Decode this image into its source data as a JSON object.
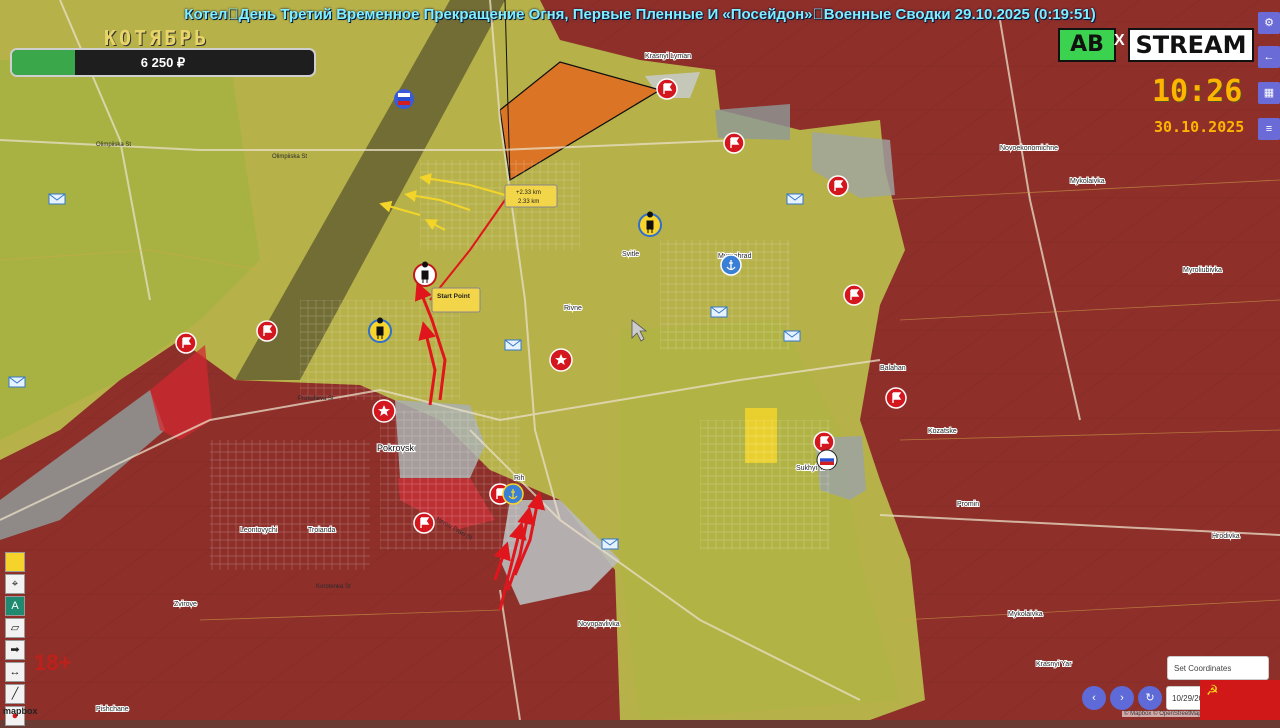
{
  "title": "Котел\u0000День Третий Временное Прекращение Огня, Первые Пленные И «Посейдон»\u0000Военные Сводки 29.10.2025 (0:19:51)",
  "month_label": "КОТЯБРЬ",
  "donation": {
    "amount": "6 250 ₽",
    "progress": 0.21
  },
  "logo": {
    "ab": "AB",
    "x": "X",
    "stream": "STREAM"
  },
  "clock": "10:26",
  "date": "30.10.2025",
  "colors": {
    "russian_control": "#8e2f2a",
    "ukrainian_control": "#b8b64a",
    "gray_zone": "#8f9a98",
    "assault_arrow": "#e0161c",
    "advance_arrow": "#f3d52a"
  },
  "places": {
    "krasnyi_lyman": "Krasnyi Lyman",
    "novoekonomichne": "Novoekonomichne",
    "mykolaivka_n": "Mykolaivka",
    "myroliubivka": "Myroliubivka",
    "balahan": "Balahan",
    "kozatske": "Kozatske",
    "promin": "Promin",
    "hrodivka": "Hrodivka",
    "mykolaivka_s": "Mykolaivka",
    "krasnyi_yar": "Krasnyi Yar",
    "novopavlivka": "Novopavlivka",
    "pishchane": "Pishchane",
    "zvirove": "Zvirove",
    "leontovychi": "Leontovychi",
    "troianda": "Troianda",
    "pokrovsk": "Pokrovsk",
    "rih": "Rih",
    "rivne": "Rivne",
    "svitle": "Svitle",
    "myrnohrad": "Myrnohrad",
    "sukhyi_yar": "Sukhyi Yar"
  },
  "streets": {
    "olimpiiska_w": "Olimpiiska St",
    "olimpiiska_e": "Olimpiiska St",
    "prokofieva": "Prokofieva St",
    "korotenka": "Korotenka St",
    "heroiv": "Heroiv Praci St"
  },
  "annotations": {
    "distance_line1": "+2.33 km",
    "distance_line2": "2.33 km",
    "start_point": "Start Point"
  },
  "controls": {
    "set_coordinates": "Set Coordinates",
    "date_value": "10/29/2025",
    "prev": "‹",
    "next": "›",
    "refresh": "↻",
    "age_rating": "18+",
    "mapbox": "mapbox",
    "attribution": "© Mapbox © OpenStreetMap"
  },
  "side_buttons": [
    "⚙",
    "←",
    "▦",
    "≡"
  ],
  "tools": [
    "",
    "⌖",
    "A",
    "▱",
    "➡",
    "↔",
    "╱",
    "●"
  ],
  "icons": {
    "flag": "flag-icon",
    "star": "star-icon",
    "envelope": "mail-icon",
    "soldier": "soldier-icon",
    "anchor": "anchor-icon"
  }
}
